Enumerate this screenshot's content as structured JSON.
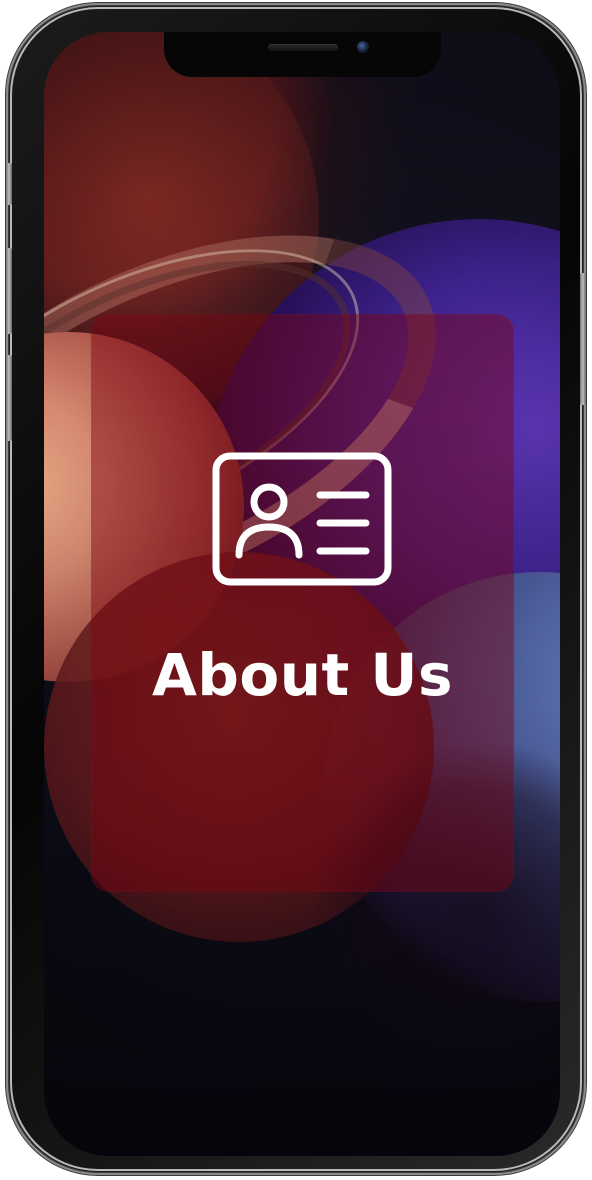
{
  "card": {
    "title": "About Us",
    "icon": "id-card-icon",
    "background_color": "#7c0512",
    "title_color": "#ffffff"
  },
  "device": {
    "frame": "smartphone",
    "camera": "camera-icon"
  }
}
